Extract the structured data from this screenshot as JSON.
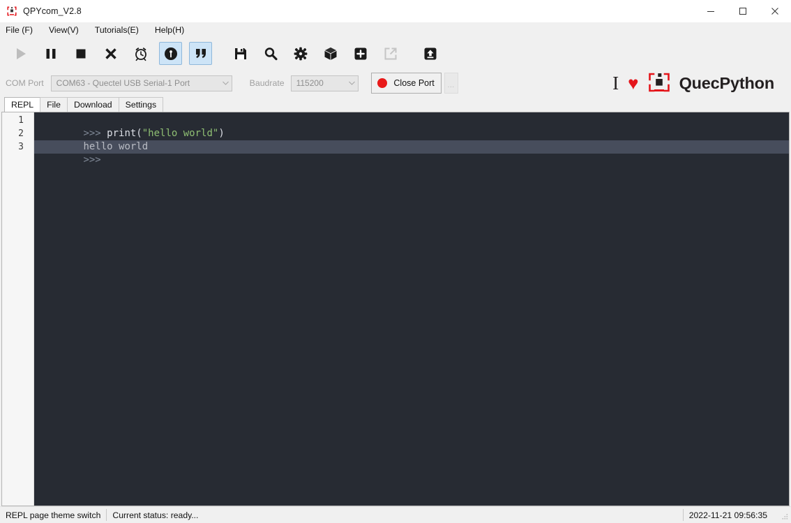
{
  "window": {
    "title": "QPYcom_V2.8",
    "app_icon": "quecpython-logo-icon",
    "minimize_label": "—",
    "maximize_label": "□",
    "close_label": "✕"
  },
  "menu": {
    "items": [
      {
        "label": "File (F)",
        "text": "File (F)",
        "mnemonic": "F"
      },
      {
        "label": "View(V)",
        "text": "View(V)",
        "mnemonic": "V"
      },
      {
        "label": "Tutorials(E)",
        "text": "Tutorials(E)",
        "mnemonic": "E"
      },
      {
        "label": "Help(H)",
        "text": "Help(H)",
        "mnemonic": "H"
      }
    ]
  },
  "toolbar": {
    "group1": [
      {
        "name": "run-button",
        "icon": "play-icon",
        "state": "disabled"
      },
      {
        "name": "pause-button",
        "icon": "pause-icon",
        "state": "enabled"
      },
      {
        "name": "stop-button",
        "icon": "stop-icon",
        "state": "enabled"
      },
      {
        "name": "close-button",
        "icon": "close-x-icon",
        "state": "enabled"
      },
      {
        "name": "timer-button",
        "icon": "alarm-clock-icon",
        "state": "enabled"
      },
      {
        "name": "repl-mode-button",
        "icon": "python-repl-icon",
        "state": "active"
      },
      {
        "name": "quote-button",
        "icon": "quotation-marks-icon",
        "state": "active"
      }
    ],
    "group2": [
      {
        "name": "save-button",
        "icon": "floppy-save-icon",
        "state": "enabled"
      },
      {
        "name": "search-button",
        "icon": "magnifier-search-icon",
        "state": "enabled"
      },
      {
        "name": "settings-button",
        "icon": "gear-icon",
        "state": "enabled"
      },
      {
        "name": "package-button",
        "icon": "cube-package-icon",
        "state": "enabled"
      },
      {
        "name": "add-button",
        "icon": "plus-box-icon",
        "state": "enabled"
      },
      {
        "name": "external-link-button",
        "icon": "external-link-icon",
        "state": "disabled"
      },
      {
        "name": "upload-button",
        "icon": "upload-arrow-icon",
        "state": "enabled"
      }
    ]
  },
  "port_row": {
    "com_label": "COM Port",
    "com_value": "COM63 - Quectel USB Serial-1 Port",
    "baud_label": "Baudrate",
    "baud_value": "115200",
    "close_port_label": "Close Port",
    "status_dot_color": "#e81a1a",
    "more_label": "..."
  },
  "brand": {
    "i_glyph": "I",
    "heart_glyph": "♥",
    "heart_color": "#e4151b",
    "logo_icon": "quecpython-logo-icon",
    "name": "QuecPython"
  },
  "tabs": {
    "items": [
      {
        "label": "REPL",
        "selected": true
      },
      {
        "label": "File",
        "selected": false
      },
      {
        "label": "Download",
        "selected": false
      },
      {
        "label": "Settings",
        "selected": false
      }
    ]
  },
  "editor": {
    "background": "#272b33",
    "current_line_background": "#474d5c",
    "line_numbers": [
      "1",
      "2",
      "3"
    ],
    "lines": [
      {
        "number": "1",
        "current": false,
        "tokens": [
          {
            "text": ">>> ",
            "type": "prompt"
          },
          {
            "text": "print(",
            "type": "fn"
          },
          {
            "text": "\"hello world\"",
            "type": "str"
          },
          {
            "text": ")",
            "type": "fn"
          }
        ]
      },
      {
        "number": "2",
        "current": false,
        "tokens": [
          {
            "text": "hello world",
            "type": "out"
          }
        ]
      },
      {
        "number": "3",
        "current": true,
        "tokens": [
          {
            "text": ">>> ",
            "type": "prompt"
          }
        ]
      }
    ]
  },
  "statusbar": {
    "theme_switch_label": "REPL page theme switch",
    "status_label": "Current status: ready...",
    "timestamp": "2022-11-21 09:56:35",
    "grip_icon": "resize-grip-icon"
  }
}
